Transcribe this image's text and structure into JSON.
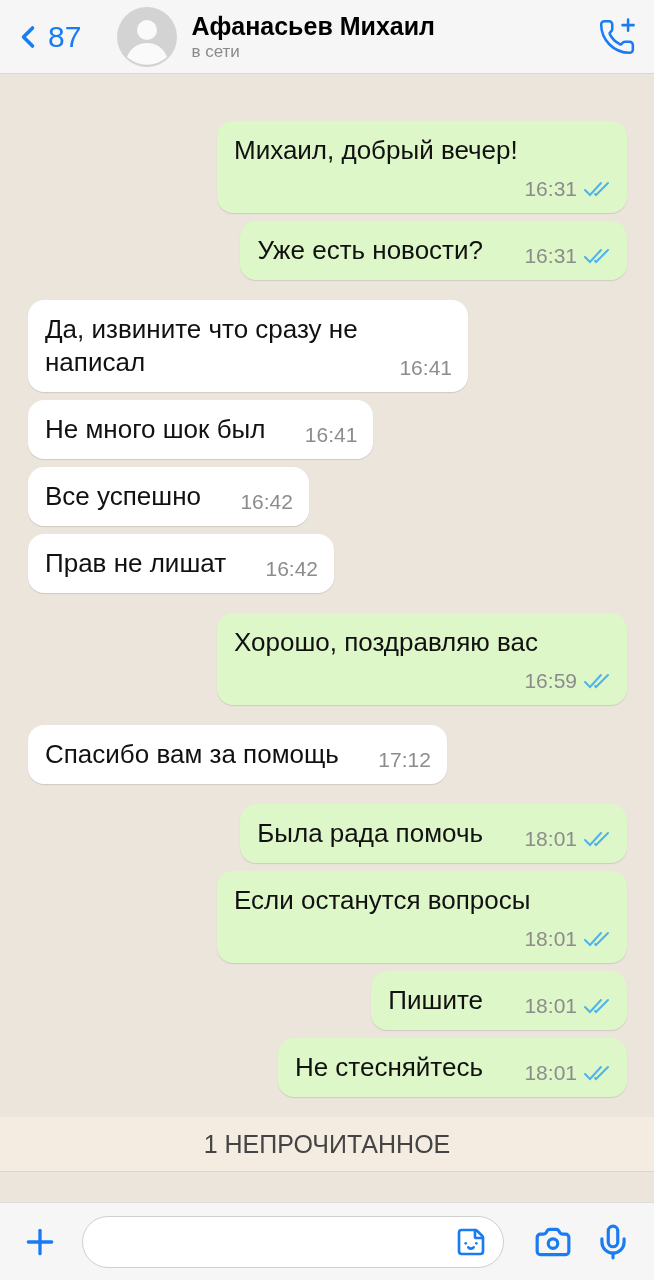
{
  "header": {
    "back_count": "87",
    "contact_name": "Афанасьев Михаил",
    "status": "в сети"
  },
  "messages": [
    {
      "kind": "out",
      "text": "Михаил, добрый вечер!",
      "time": "16:31",
      "read": true
    },
    {
      "kind": "out",
      "text": "Уже есть новости?",
      "time": "16:31",
      "read": true
    },
    {
      "kind": "in",
      "text": "Да, извините что сразу не написал",
      "time": "16:41"
    },
    {
      "kind": "in",
      "text": "Не много шок был",
      "time": "16:41"
    },
    {
      "kind": "in",
      "text": "Все успешно",
      "time": "16:42"
    },
    {
      "kind": "in",
      "text": "Прав не лишат",
      "time": "16:42"
    },
    {
      "kind": "out",
      "text": "Хорошо, поздравляю вас",
      "time": "16:59",
      "read": true
    },
    {
      "kind": "in",
      "text": "Спасибо вам за помощь",
      "time": "17:12"
    },
    {
      "kind": "out",
      "text": "Была рада помочь",
      "time": "18:01",
      "read": true
    },
    {
      "kind": "out",
      "text": "Если останутся вопросы",
      "time": "18:01",
      "read": true
    },
    {
      "kind": "out",
      "text": "Пишите",
      "time": "18:01",
      "read": true
    },
    {
      "kind": "out",
      "text": "Не стесняйтесь",
      "time": "18:01",
      "read": true
    }
  ],
  "unread_banner": "1 НЕПРОЧИТАННОЕ"
}
